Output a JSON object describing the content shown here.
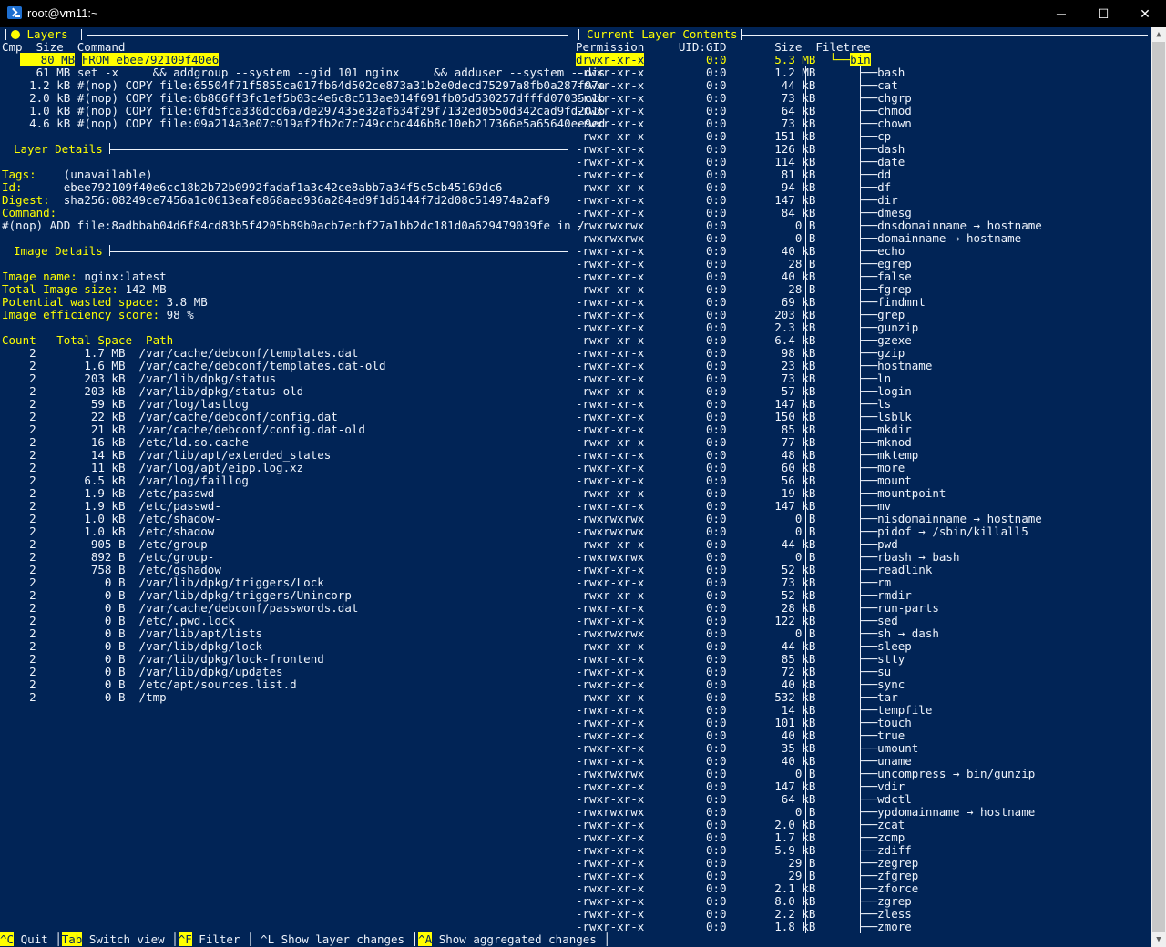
{
  "window": {
    "title": "root@vm11:~",
    "controls": {
      "minimize": "─",
      "maximize": "☐",
      "close": "✕"
    }
  },
  "layers_panel": {
    "title": "Layers",
    "header": "Cmp  Size  Command",
    "rows": [
      {
        "size": "80 MB",
        "command": "FROM ebee792109f40e6",
        "selected": true
      },
      {
        "size": "61 MB",
        "command": "set -x     && addgroup --system --gid 101 nginx     && adduser --system --dis"
      },
      {
        "size": "1.2 kB",
        "command": "#(nop) COPY file:65504f71f5855ca017fb64d502ce873a31b2e0decd75297a8fb0a287f97a"
      },
      {
        "size": "2.0 kB",
        "command": "#(nop) COPY file:0b866ff3fc1ef5b03c4e6c8c513ae014f691fb05d530257dfffd07035c1b"
      },
      {
        "size": "1.0 kB",
        "command": "#(nop) COPY file:0fd5fca330dcd6a7de297435e32af634f29f7132ed0550d342cad9fd2015"
      },
      {
        "size": "4.6 kB",
        "command": "#(nop) COPY file:09a214a3e07c919af2fb2d7c749ccbc446b8c10eb217366e5a65640ee9ed"
      }
    ]
  },
  "layer_details": {
    "title": "Layer Details",
    "tags_label": "Tags:",
    "tags_value": "(unavailable)",
    "id_label": "Id:",
    "id_value": "ebee792109f40e6cc18b2b72b0992fadaf1a3c42ce8abb7a34f5c5cb45169dc6",
    "digest_label": "Digest:",
    "digest_value": "sha256:08249ce7456a1c0613eafe868aed936a284ed9f1d6144f7d2d08c514974a2af9",
    "command_label": "Command:",
    "command_value": "#(nop) ADD file:8adbbab04d6f84cd83b5f4205b89b0acb7ecbf27a1bb2dc181d0a629479039fe in /"
  },
  "image_details": {
    "title": "Image Details",
    "name_label": "Image name:",
    "name_value": "nginx:latest",
    "size_label": "Total Image size:",
    "size_value": "142 MB",
    "wasted_label": "Potential wasted space:",
    "wasted_value": "3.8 MB",
    "efficiency_label": "Image efficiency score:",
    "efficiency_value": "98 %",
    "table_header": "Count   Total Space  Path",
    "rows": [
      [
        "2",
        "1.7 MB",
        "/var/cache/debconf/templates.dat"
      ],
      [
        "2",
        "1.6 MB",
        "/var/cache/debconf/templates.dat-old"
      ],
      [
        "2",
        "203 kB",
        "/var/lib/dpkg/status"
      ],
      [
        "2",
        "203 kB",
        "/var/lib/dpkg/status-old"
      ],
      [
        "2",
        "59 kB",
        "/var/log/lastlog"
      ],
      [
        "2",
        "22 kB",
        "/var/cache/debconf/config.dat"
      ],
      [
        "2",
        "21 kB",
        "/var/cache/debconf/config.dat-old"
      ],
      [
        "2",
        "16 kB",
        "/etc/ld.so.cache"
      ],
      [
        "2",
        "14 kB",
        "/var/lib/apt/extended_states"
      ],
      [
        "2",
        "11 kB",
        "/var/log/apt/eipp.log.xz"
      ],
      [
        "2",
        "6.5 kB",
        "/var/log/faillog"
      ],
      [
        "2",
        "1.9 kB",
        "/etc/passwd"
      ],
      [
        "2",
        "1.9 kB",
        "/etc/passwd-"
      ],
      [
        "2",
        "1.0 kB",
        "/etc/shadow-"
      ],
      [
        "2",
        "1.0 kB",
        "/etc/shadow"
      ],
      [
        "2",
        "905 B",
        "/etc/group"
      ],
      [
        "2",
        "892 B",
        "/etc/group-"
      ],
      [
        "2",
        "758 B",
        "/etc/gshadow"
      ],
      [
        "2",
        "0 B",
        "/var/lib/dpkg/triggers/Lock"
      ],
      [
        "2",
        "0 B",
        "/var/lib/dpkg/triggers/Unincorp"
      ],
      [
        "2",
        "0 B",
        "/var/cache/debconf/passwords.dat"
      ],
      [
        "2",
        "0 B",
        "/etc/.pwd.lock"
      ],
      [
        "2",
        "0 B",
        "/var/lib/apt/lists"
      ],
      [
        "2",
        "0 B",
        "/var/lib/dpkg/lock"
      ],
      [
        "2",
        "0 B",
        "/var/lib/dpkg/lock-frontend"
      ],
      [
        "2",
        "0 B",
        "/var/lib/dpkg/updates"
      ],
      [
        "2",
        "0 B",
        "/etc/apt/sources.list.d"
      ],
      [
        "2",
        "0 B",
        "/tmp"
      ]
    ]
  },
  "contents_panel": {
    "title": "Current Layer Contents",
    "header": "Permission     UID:GID       Size  Filetree",
    "root": {
      "perm": "drwxr-xr-x",
      "uid": "0:0",
      "size": "5.3 MB",
      "name": "bin"
    },
    "files": [
      [
        "-rwxr-xr-x",
        "0:0",
        "1.2 MB",
        "bash"
      ],
      [
        "-rwxr-xr-x",
        "0:0",
        "44 kB",
        "cat"
      ],
      [
        "-rwxr-xr-x",
        "0:0",
        "73 kB",
        "chgrp"
      ],
      [
        "-rwxr-xr-x",
        "0:0",
        "64 kB",
        "chmod"
      ],
      [
        "-rwxr-xr-x",
        "0:0",
        "73 kB",
        "chown"
      ],
      [
        "-rwxr-xr-x",
        "0:0",
        "151 kB",
        "cp"
      ],
      [
        "-rwxr-xr-x",
        "0:0",
        "126 kB",
        "dash"
      ],
      [
        "-rwxr-xr-x",
        "0:0",
        "114 kB",
        "date"
      ],
      [
        "-rwxr-xr-x",
        "0:0",
        "81 kB",
        "dd"
      ],
      [
        "-rwxr-xr-x",
        "0:0",
        "94 kB",
        "df"
      ],
      [
        "-rwxr-xr-x",
        "0:0",
        "147 kB",
        "dir"
      ],
      [
        "-rwxr-xr-x",
        "0:0",
        "84 kB",
        "dmesg"
      ],
      [
        "-rwxrwxrwx",
        "0:0",
        "0 B",
        "dnsdomainname → hostname"
      ],
      [
        "-rwxrwxrwx",
        "0:0",
        "0 B",
        "domainname → hostname"
      ],
      [
        "-rwxr-xr-x",
        "0:0",
        "40 kB",
        "echo"
      ],
      [
        "-rwxr-xr-x",
        "0:0",
        "28 B",
        "egrep"
      ],
      [
        "-rwxr-xr-x",
        "0:0",
        "40 kB",
        "false"
      ],
      [
        "-rwxr-xr-x",
        "0:0",
        "28 B",
        "fgrep"
      ],
      [
        "-rwxr-xr-x",
        "0:0",
        "69 kB",
        "findmnt"
      ],
      [
        "-rwxr-xr-x",
        "0:0",
        "203 kB",
        "grep"
      ],
      [
        "-rwxr-xr-x",
        "0:0",
        "2.3 kB",
        "gunzip"
      ],
      [
        "-rwxr-xr-x",
        "0:0",
        "6.4 kB",
        "gzexe"
      ],
      [
        "-rwxr-xr-x",
        "0:0",
        "98 kB",
        "gzip"
      ],
      [
        "-rwxr-xr-x",
        "0:0",
        "23 kB",
        "hostname"
      ],
      [
        "-rwxr-xr-x",
        "0:0",
        "73 kB",
        "ln"
      ],
      [
        "-rwxr-xr-x",
        "0:0",
        "57 kB",
        "login"
      ],
      [
        "-rwxr-xr-x",
        "0:0",
        "147 kB",
        "ls"
      ],
      [
        "-rwxr-xr-x",
        "0:0",
        "150 kB",
        "lsblk"
      ],
      [
        "-rwxr-xr-x",
        "0:0",
        "85 kB",
        "mkdir"
      ],
      [
        "-rwxr-xr-x",
        "0:0",
        "77 kB",
        "mknod"
      ],
      [
        "-rwxr-xr-x",
        "0:0",
        "48 kB",
        "mktemp"
      ],
      [
        "-rwxr-xr-x",
        "0:0",
        "60 kB",
        "more"
      ],
      [
        "-rwxr-xr-x",
        "0:0",
        "56 kB",
        "mount"
      ],
      [
        "-rwxr-xr-x",
        "0:0",
        "19 kB",
        "mountpoint"
      ],
      [
        "-rwxr-xr-x",
        "0:0",
        "147 kB",
        "mv"
      ],
      [
        "-rwxrwxrwx",
        "0:0",
        "0 B",
        "nisdomainname → hostname"
      ],
      [
        "-rwxrwxrwx",
        "0:0",
        "0 B",
        "pidof → /sbin/killall5"
      ],
      [
        "-rwxr-xr-x",
        "0:0",
        "44 kB",
        "pwd"
      ],
      [
        "-rwxrwxrwx",
        "0:0",
        "0 B",
        "rbash → bash"
      ],
      [
        "-rwxr-xr-x",
        "0:0",
        "52 kB",
        "readlink"
      ],
      [
        "-rwxr-xr-x",
        "0:0",
        "73 kB",
        "rm"
      ],
      [
        "-rwxr-xr-x",
        "0:0",
        "52 kB",
        "rmdir"
      ],
      [
        "-rwxr-xr-x",
        "0:0",
        "28 kB",
        "run-parts"
      ],
      [
        "-rwxr-xr-x",
        "0:0",
        "122 kB",
        "sed"
      ],
      [
        "-rwxrwxrwx",
        "0:0",
        "0 B",
        "sh → dash"
      ],
      [
        "-rwxr-xr-x",
        "0:0",
        "44 kB",
        "sleep"
      ],
      [
        "-rwxr-xr-x",
        "0:0",
        "85 kB",
        "stty"
      ],
      [
        "-rwxr-xr-x",
        "0:0",
        "72 kB",
        "su"
      ],
      [
        "-rwxr-xr-x",
        "0:0",
        "40 kB",
        "sync"
      ],
      [
        "-rwxr-xr-x",
        "0:0",
        "532 kB",
        "tar"
      ],
      [
        "-rwxr-xr-x",
        "0:0",
        "14 kB",
        "tempfile"
      ],
      [
        "-rwxr-xr-x",
        "0:0",
        "101 kB",
        "touch"
      ],
      [
        "-rwxr-xr-x",
        "0:0",
        "40 kB",
        "true"
      ],
      [
        "-rwxr-xr-x",
        "0:0",
        "35 kB",
        "umount"
      ],
      [
        "-rwxr-xr-x",
        "0:0",
        "40 kB",
        "uname"
      ],
      [
        "-rwxrwxrwx",
        "0:0",
        "0 B",
        "uncompress → bin/gunzip"
      ],
      [
        "-rwxr-xr-x",
        "0:0",
        "147 kB",
        "vdir"
      ],
      [
        "-rwxr-xr-x",
        "0:0",
        "64 kB",
        "wdctl"
      ],
      [
        "-rwxrwxrwx",
        "0:0",
        "0 B",
        "ypdomainname → hostname"
      ],
      [
        "-rwxr-xr-x",
        "0:0",
        "2.0 kB",
        "zcat"
      ],
      [
        "-rwxr-xr-x",
        "0:0",
        "1.7 kB",
        "zcmp"
      ],
      [
        "-rwxr-xr-x",
        "0:0",
        "5.9 kB",
        "zdiff"
      ],
      [
        "-rwxr-xr-x",
        "0:0",
        "29 B",
        "zegrep"
      ],
      [
        "-rwxr-xr-x",
        "0:0",
        "29 B",
        "zfgrep"
      ],
      [
        "-rwxr-xr-x",
        "0:0",
        "2.1 kB",
        "zforce"
      ],
      [
        "-rwxr-xr-x",
        "0:0",
        "8.0 kB",
        "zgrep"
      ],
      [
        "-rwxr-xr-x",
        "0:0",
        "2.2 kB",
        "zless"
      ],
      [
        "-rwxr-xr-x",
        "0:0",
        "1.8 kB",
        "zmore"
      ]
    ]
  },
  "footer": {
    "items": [
      {
        "key": "^C",
        "label": " Quit "
      },
      {
        "key": "Tab",
        "label": " Switch view "
      },
      {
        "key": "^F",
        "label": " Filter "
      },
      {
        "key": "",
        "label": " ^L Show layer changes "
      },
      {
        "key": "^A",
        "label": " Show aggregated changes "
      }
    ]
  },
  "colors": {
    "background": "#012456",
    "accent": "#ffff00",
    "text": "#eef3fb"
  }
}
